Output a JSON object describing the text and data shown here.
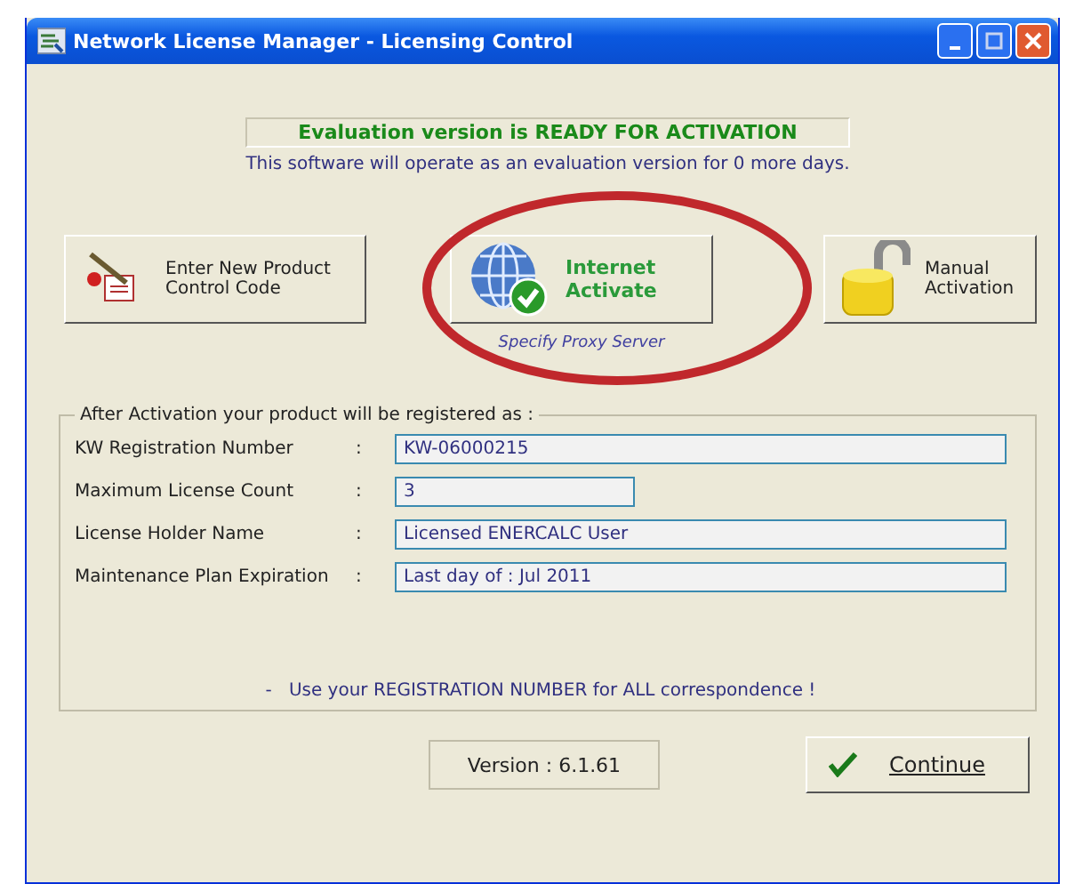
{
  "window": {
    "title": "Network License Manager - Licensing Control"
  },
  "status": {
    "headline": "Evaluation version is READY FOR ACTIVATION",
    "detail": "This software will operate as an evaluation version for 0 more days."
  },
  "actions": [
    {
      "kind": "code",
      "lines": [
        "Enter New Product",
        "Control Code"
      ]
    },
    {
      "kind": "internet",
      "lines": [
        "Internet",
        "Activate"
      ]
    },
    {
      "kind": "manual",
      "lines": [
        "Manual",
        "Activation"
      ]
    }
  ],
  "proxy_link": "Specify Proxy Server",
  "registration": {
    "title": "After Activation your product will be registered as :",
    "fields": [
      {
        "label": "KW Registration Number",
        "separator": ":",
        "value": "KW-06000215",
        "kind": "wide"
      },
      {
        "label": "Maximum License Count",
        "separator": ":",
        "value": "3",
        "kind": "short"
      },
      {
        "label": "License Holder Name",
        "separator": ":",
        "value": "Licensed ENERCALC User",
        "kind": "wide"
      },
      {
        "label": "Maintenance Plan Expiration",
        "separator": ":",
        "value": "Last day of : Jul 2011",
        "kind": "wide"
      }
    ],
    "note": "-   Use your REGISTRATION NUMBER for ALL correspondence !"
  },
  "version": "Version : 6.1.61",
  "continue_button": "Continue"
}
